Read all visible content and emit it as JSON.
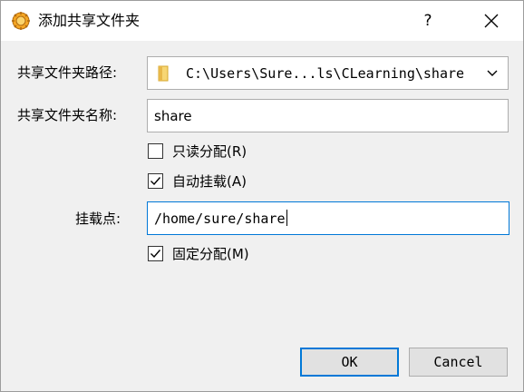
{
  "window": {
    "title": "添加共享文件夹",
    "help_glyph": "?",
    "icon": "virtualbox-app-icon"
  },
  "form": {
    "path_label": "共享文件夹路径:",
    "path_value": "C:\\Users\\Sure...ls\\CLearning\\share",
    "name_label": "共享文件夹名称:",
    "name_value": "share",
    "readonly": {
      "label": "只读分配(R)",
      "checked": false
    },
    "automount": {
      "label": "自动挂载(A)",
      "checked": true
    },
    "mountpoint_label": "挂载点:",
    "mountpoint_value": "/home/sure/share",
    "permanent": {
      "label": "固定分配(M)",
      "checked": true
    }
  },
  "buttons": {
    "ok": "OK",
    "cancel": "Cancel"
  },
  "colors": {
    "accent": "#0078d7",
    "background": "#f0f0f0",
    "titlebar": "#ffffff"
  }
}
